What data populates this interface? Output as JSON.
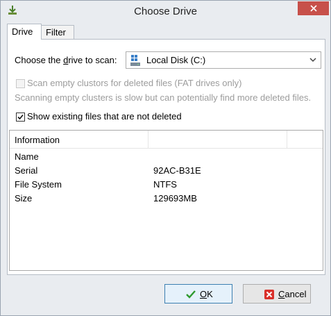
{
  "window": {
    "title": "Choose Drive"
  },
  "tabs": [
    {
      "label": "Drive",
      "active": true
    },
    {
      "label": "Filter",
      "active": false
    }
  ],
  "drive": {
    "choose_label_pre": "Choose the ",
    "choose_label_u": "d",
    "choose_label_post": "rive to scan:",
    "selected": "Local Disk (C:)"
  },
  "options": {
    "scan_empty": {
      "label": "Scan empty clustors for deleted files (FAT drives only)",
      "checked": false,
      "enabled": false
    },
    "hint": "Scanning empty clusters is slow but can potentially find more deleted files.",
    "show_existing": {
      "label": "Show existing files that are not deleted",
      "checked": true
    }
  },
  "info": {
    "header": "Information",
    "rows": [
      {
        "key": "Name",
        "value": ""
      },
      {
        "key": "Serial",
        "value": "92AC-B31E"
      },
      {
        "key": "File System",
        "value": "NTFS"
      },
      {
        "key": "Size",
        "value": "129693MB"
      }
    ]
  },
  "buttons": {
    "ok_u": "O",
    "ok_rest": "K",
    "cancel_u": "C",
    "cancel_rest": "ancel"
  },
  "colors": {
    "close": "#c7504a",
    "ok_border": "#3c7fb1",
    "check_green": "#2e9a2e",
    "cancel_red": "#d9302a"
  }
}
